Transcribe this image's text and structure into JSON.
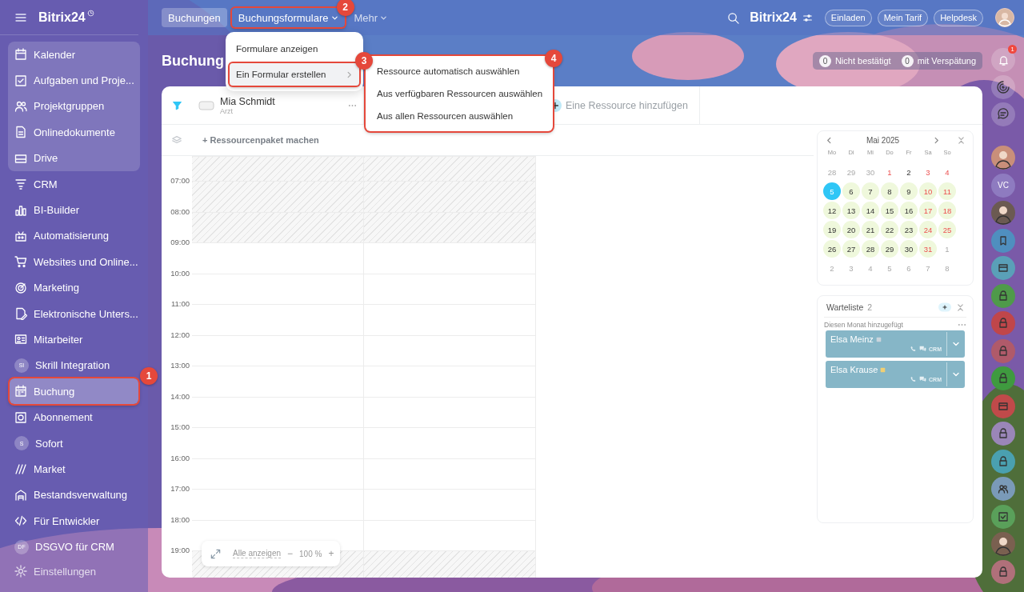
{
  "sidebar": {
    "logo": "Bitrix24",
    "pinned_items": [
      {
        "label": "Kalender",
        "kind": "icon",
        "selected": false
      },
      {
        "label": "Aufgaben und Proje...",
        "kind": "icon",
        "selected": false
      },
      {
        "label": "Projektgruppen",
        "kind": "icon",
        "selected": false
      },
      {
        "label": "Onlinedokumente",
        "kind": "icon",
        "selected": false
      },
      {
        "label": "Drive",
        "kind": "icon",
        "selected": false
      }
    ],
    "items": [
      {
        "label": "CRM",
        "kind": "icon",
        "selected": false
      },
      {
        "label": "BI-Builder",
        "kind": "icon",
        "selected": false
      },
      {
        "label": "Automatisierung",
        "kind": "icon",
        "selected": false
      },
      {
        "label": "Websites und Online...",
        "kind": "icon",
        "selected": false
      },
      {
        "label": "Marketing",
        "kind": "icon",
        "selected": false
      },
      {
        "label": "Elektronische Unters...",
        "kind": "icon",
        "selected": false
      },
      {
        "label": "Mitarbeiter",
        "kind": "icon",
        "selected": false
      },
      {
        "label": "Skrill Integration",
        "kind": "initials",
        "initials": "SI",
        "selected": false
      },
      {
        "label": "Buchung",
        "kind": "icon",
        "selected": true,
        "callout": "1"
      },
      {
        "label": "Abonnement",
        "kind": "icon",
        "selected": false
      },
      {
        "label": "Sofort",
        "kind": "initials",
        "initials": "S",
        "selected": false
      },
      {
        "label": "Market",
        "kind": "icon",
        "selected": false
      },
      {
        "label": "Bestandsverwaltung",
        "kind": "icon",
        "selected": false
      },
      {
        "label": "Für Entwickler",
        "kind": "icon",
        "selected": false
      },
      {
        "label": "DSGVO für CRM",
        "kind": "initials",
        "initials": "DF",
        "selected": false
      }
    ],
    "settings": "Einstellungen"
  },
  "topbar": {
    "tabs": [
      {
        "label": "Buchungen",
        "selected": true,
        "dropdown": false
      },
      {
        "label": "Buchungsformulare",
        "selected": false,
        "dropdown": true,
        "callout": "2"
      },
      {
        "label": "Mehr",
        "selected": false,
        "dropdown": true
      }
    ],
    "portal": "Bitrix24",
    "buttons": [
      "Einladen",
      "Mein Tarif",
      "Helpdesk"
    ]
  },
  "header": {
    "title": "Buchung",
    "counters": [
      {
        "count": "0",
        "label": "Nicht bestätigt"
      },
      {
        "count": "0",
        "label": "mit Verspätung"
      }
    ]
  },
  "menu": {
    "items": [
      {
        "label": "Formulare anzeigen",
        "selected": false,
        "submenu": false
      },
      {
        "label": "Ein Formular erstellen",
        "selected": true,
        "submenu": true,
        "callout": "3"
      }
    ],
    "submenu": {
      "callout": "4",
      "items": [
        "Ressource automatisch auswählen",
        "Aus verfügbaren Ressourcen auswählen",
        "Aus allen Ressourcen auswählen"
      ]
    }
  },
  "resources": [
    {
      "name": "Mia Schmidt",
      "role": "Arzt"
    }
  ],
  "add_resource": "Eine Ressource hinzufügen",
  "package_button": "+ Ressourcenpaket machen",
  "schedule": {
    "rows": [
      {
        "available": [
          false,
          false
        ]
      },
      {
        "time": "07:00",
        "available": [
          false,
          false
        ]
      },
      {
        "time": "08:00",
        "available": [
          false,
          false
        ]
      },
      {
        "time": "09:00",
        "available": [
          true,
          true
        ]
      },
      {
        "time": "10:00",
        "available": [
          true,
          true
        ]
      },
      {
        "time": "11:00",
        "available": [
          true,
          true
        ]
      },
      {
        "time": "12:00",
        "available": [
          true,
          true
        ]
      },
      {
        "time": "13:00",
        "available": [
          true,
          true
        ]
      },
      {
        "time": "14:00",
        "available": [
          true,
          true
        ]
      },
      {
        "time": "15:00",
        "available": [
          true,
          true
        ]
      },
      {
        "time": "16:00",
        "available": [
          true,
          true
        ]
      },
      {
        "time": "17:00",
        "available": [
          true,
          true
        ]
      },
      {
        "time": "18:00",
        "available": [
          true,
          true
        ]
      },
      {
        "time": "19:00",
        "available": [
          false,
          false
        ]
      }
    ]
  },
  "zoom": {
    "show_all": "Alle anzeigen",
    "minus": "−",
    "value": "100 %",
    "plus": "+"
  },
  "calendar": {
    "month": "Mai 2025",
    "weekdays": [
      "Mo",
      "Di",
      "Mi",
      "Do",
      "Fr",
      "Sa",
      "So"
    ],
    "weeks": [
      [
        {
          "d": "28",
          "kind": "other",
          "selected": false
        },
        {
          "d": "29",
          "kind": "other",
          "selected": false
        },
        {
          "d": "30",
          "kind": "other",
          "selected": false
        },
        {
          "d": "1",
          "kind": "holiday",
          "selected": false
        },
        {
          "d": "2",
          "kind": "plain",
          "selected": false
        },
        {
          "d": "3",
          "kind": "holiday",
          "selected": false
        },
        {
          "d": "4",
          "kind": "holiday",
          "selected": false
        }
      ],
      [
        {
          "d": "5",
          "kind": "free",
          "selected": true
        },
        {
          "d": "6",
          "kind": "free",
          "selected": false
        },
        {
          "d": "7",
          "kind": "free",
          "selected": false
        },
        {
          "d": "8",
          "kind": "free",
          "selected": false
        },
        {
          "d": "9",
          "kind": "free",
          "selected": false
        },
        {
          "d": "10",
          "kind": "free_holiday",
          "selected": false
        },
        {
          "d": "11",
          "kind": "free_holiday",
          "selected": false
        }
      ],
      [
        {
          "d": "12",
          "kind": "free",
          "selected": false
        },
        {
          "d": "13",
          "kind": "free",
          "selected": false
        },
        {
          "d": "14",
          "kind": "free",
          "selected": false
        },
        {
          "d": "15",
          "kind": "free",
          "selected": false
        },
        {
          "d": "16",
          "kind": "free",
          "selected": false
        },
        {
          "d": "17",
          "kind": "free_holiday",
          "selected": false
        },
        {
          "d": "18",
          "kind": "free_holiday",
          "selected": false
        }
      ],
      [
        {
          "d": "19",
          "kind": "free",
          "selected": false
        },
        {
          "d": "20",
          "kind": "free",
          "selected": false
        },
        {
          "d": "21",
          "kind": "free",
          "selected": false
        },
        {
          "d": "22",
          "kind": "free",
          "selected": false
        },
        {
          "d": "23",
          "kind": "free",
          "selected": false
        },
        {
          "d": "24",
          "kind": "free_holiday",
          "selected": false
        },
        {
          "d": "25",
          "kind": "free_holiday",
          "selected": false
        }
      ],
      [
        {
          "d": "26",
          "kind": "free",
          "selected": false
        },
        {
          "d": "27",
          "kind": "free",
          "selected": false
        },
        {
          "d": "28",
          "kind": "free",
          "selected": false
        },
        {
          "d": "29",
          "kind": "free",
          "selected": false
        },
        {
          "d": "30",
          "kind": "free",
          "selected": false
        },
        {
          "d": "31",
          "kind": "free_holiday",
          "selected": false
        },
        {
          "d": "1",
          "kind": "other",
          "selected": false
        }
      ],
      [
        {
          "d": "2",
          "kind": "other",
          "selected": false
        },
        {
          "d": "3",
          "kind": "other",
          "selected": false
        },
        {
          "d": "4",
          "kind": "other",
          "selected": false
        },
        {
          "d": "5",
          "kind": "other",
          "selected": false
        },
        {
          "d": "6",
          "kind": "other",
          "selected": false
        },
        {
          "d": "7",
          "kind": "other",
          "selected": false
        },
        {
          "d": "8",
          "kind": "other",
          "selected": false
        }
      ]
    ]
  },
  "waitlist": {
    "title": "Warteliste",
    "count": "2",
    "group": "Diesen Monat hinzugefügt",
    "entries": [
      {
        "name": "Elsa Meinz",
        "color": "#c9d4dc",
        "crm": "CRM"
      },
      {
        "name": "Elsa Krause",
        "color": "#f0cf73",
        "crm": "CRM"
      }
    ]
  },
  "right_strip": {
    "notifications": "1",
    "apps": [
      {
        "kind": "avatar",
        "color": "#c98f7a"
      },
      {
        "kind": "initials",
        "initials": "VC",
        "color": "#8e7bc0"
      },
      {
        "kind": "avatar",
        "color": "#6b5a52"
      },
      {
        "kind": "bookmark",
        "color": "#4f8fbf"
      },
      {
        "kind": "card",
        "color": "#5aa0b8"
      },
      {
        "kind": "lock",
        "color": "#4f9a4a"
      },
      {
        "kind": "lock",
        "color": "#c0464a"
      },
      {
        "kind": "lock",
        "color": "#b05a6a"
      },
      {
        "kind": "lock",
        "color": "#3f9a3f"
      },
      {
        "kind": "card",
        "color": "#c04a4a"
      },
      {
        "kind": "lock",
        "color": "#9a86b8"
      },
      {
        "kind": "lock",
        "color": "#4aa0b0"
      },
      {
        "kind": "people",
        "color": "#7a9ab8"
      },
      {
        "kind": "check",
        "color": "#5aa05a"
      },
      {
        "kind": "avatar",
        "color": "#7a6050"
      },
      {
        "kind": "lock",
        "color": "#b0707a"
      }
    ]
  }
}
